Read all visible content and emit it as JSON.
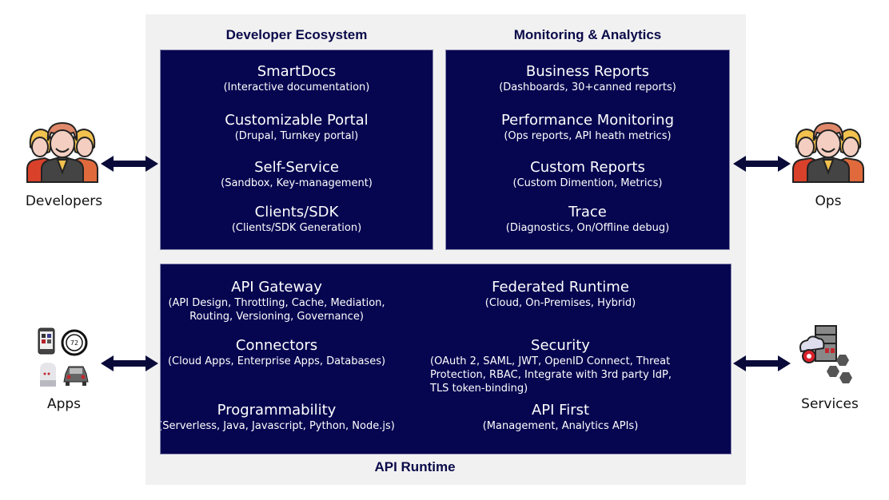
{
  "colors": {
    "box_bg": "#060550",
    "panel_bg": "#f1f1f1",
    "title": "#0a0a4a",
    "arrow": "#0a0a3a"
  },
  "sections": {
    "developer_ecosystem": {
      "title": "Developer Ecosystem",
      "items": [
        {
          "title": "SmartDocs",
          "sub": "(Interactive documentation)"
        },
        {
          "title": "Customizable Portal",
          "sub": "(Drupal, Turnkey portal)"
        },
        {
          "title": "Self-Service",
          "sub": "(Sandbox, Key-management)"
        },
        {
          "title": "Clients/SDK",
          "sub": "(Clients/SDK Generation)"
        }
      ]
    },
    "monitoring_analytics": {
      "title": "Monitoring & Analytics",
      "items": [
        {
          "title": "Business Reports",
          "sub": "(Dashboards, 30+canned reports)"
        },
        {
          "title": "Performance Monitoring",
          "sub": "(Ops reports, API heath metrics)"
        },
        {
          "title": "Custom Reports",
          "sub": "(Custom Dimention, Metrics)"
        },
        {
          "title": "Trace",
          "sub": "(Diagnostics, On/Offline debug)"
        }
      ]
    },
    "api_runtime": {
      "title": "API Runtime",
      "items": [
        {
          "title": "API Gateway",
          "sub": "(API Design, Throttling, Cache, Mediation,\nRouting, Versioning, Governance)"
        },
        {
          "title": "Federated Runtime",
          "sub": "(Cloud, On-Premises, Hybrid)"
        },
        {
          "title": "Connectors",
          "sub": "(Cloud Apps, Enterprise Apps, Databases)"
        },
        {
          "title": "Security",
          "sub": "(OAuth 2, SAML, JWT, OpenID Connect, Threat\nProtection, RBAC, Integrate with 3rd party IdP,\nTLS token-binding)"
        },
        {
          "title": "Programmability",
          "sub": "(Serverless, Java, Javascript, Python, Node.js)"
        },
        {
          "title": "API First",
          "sub": "(Management, Analytics APIs)"
        }
      ]
    }
  },
  "actors": {
    "developers": {
      "label": "Developers",
      "icon": "people-group-icon"
    },
    "ops": {
      "label": "Ops",
      "icon": "people-group-icon"
    },
    "apps": {
      "label": "Apps",
      "icon": "devices-icon"
    },
    "services": {
      "label": "Services",
      "icon": "server-cloud-icon"
    }
  },
  "device_icons": {
    "thermostat_value": "72"
  }
}
